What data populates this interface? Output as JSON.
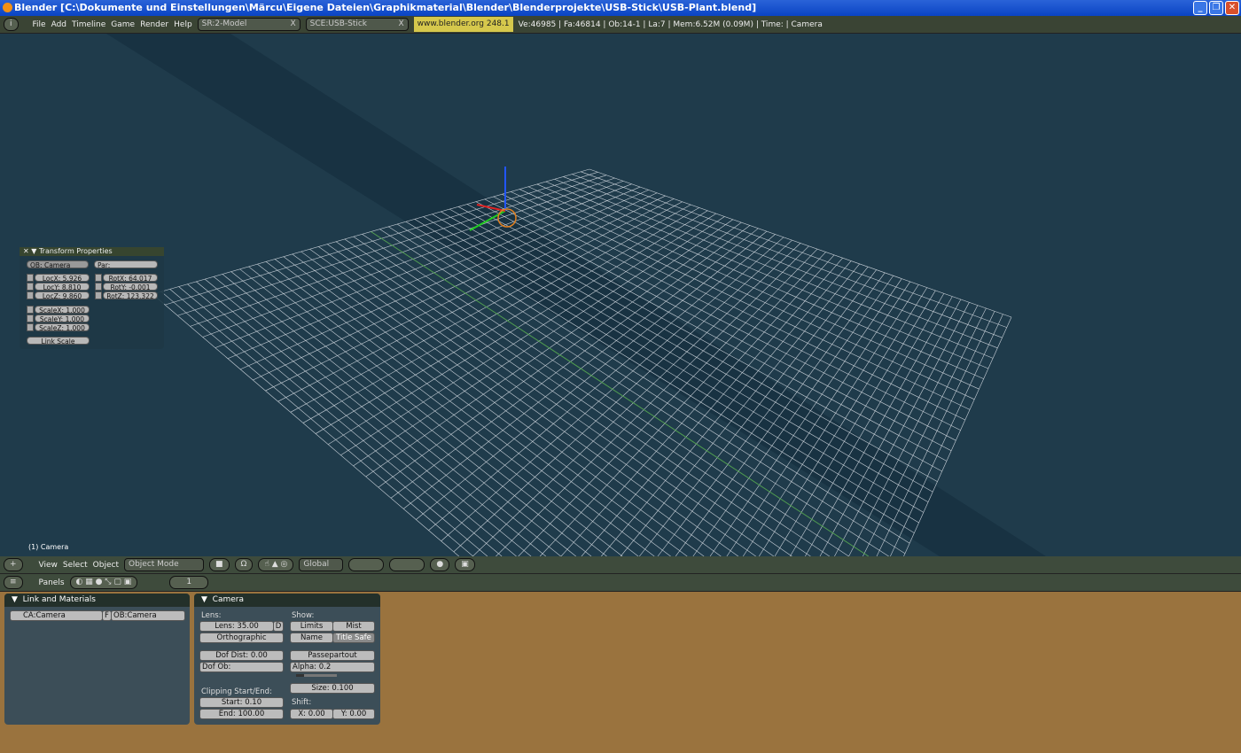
{
  "window": {
    "title": "Blender [C:\\Dokumente und Einstellungen\\Märcu\\Eigene Dateien\\Graphikmaterial\\Blender\\Blenderprojekte\\USB-Stick\\USB-Plant.blend]",
    "buttons": [
      "_",
      "❐",
      "✕"
    ]
  },
  "menubar": {
    "items": [
      "File",
      "Add",
      "Timeline",
      "Game",
      "Render",
      "Help"
    ],
    "screen": "SR:2-Model",
    "scene": "SCE:USB-Stick",
    "website": "www.blender.org 248.1",
    "stats": "Ve:46985 | Fa:46814 | Ob:14-1 | La:7  | Mem:6.52M (0.09M) | Time: | Camera"
  },
  "transform": {
    "title": "Transform Properties",
    "ob": "OB: Camera",
    "par": "Par:",
    "loc": [
      "LocX: 5.926",
      "LocY: 8.810",
      "LocZ: 9.860"
    ],
    "rot": [
      "RotX: 64.017",
      "RotY: -0.001",
      "RotZ: 123.322"
    ],
    "scale": [
      "ScaleX: 1.000",
      "ScaleY: 1.000",
      "ScaleZ: 1.000"
    ],
    "link_scale": "Link Scale"
  },
  "viewport": {
    "object_label": "(1) Camera",
    "colors": {
      "background": "#1f3b4b",
      "grid": "#c8d0d8"
    }
  },
  "view_header": {
    "menus": [
      "View",
      "Select",
      "Object"
    ],
    "mode": "Object Mode",
    "orientation": "Global"
  },
  "buttons_header": {
    "panels": "Panels",
    "frame": "1"
  },
  "link_materials": {
    "title": "Link and Materials",
    "ca": "CA:Camera",
    "f": "F",
    "ob": "OB:Camera"
  },
  "camera": {
    "title": "Camera",
    "lens_label": "Lens:",
    "lens": "Lens: 35.00",
    "d": "D",
    "ortho": "Orthographic",
    "show_label": "Show:",
    "limits": "Limits",
    "mist": "Mist",
    "name": "Name",
    "title_safe": "Title Safe",
    "dof_dist": "Dof Dist: 0.00",
    "dof_ob": "Dof Ob:",
    "passepartout": "Passepartout",
    "alpha": "Alpha: 0.2",
    "alpha_value": 0.2,
    "clip_label": "Clipping Start/End:",
    "start": "Start: 0.10",
    "end": "End: 100.00",
    "size": "Size: 0.100",
    "shift_label": "Shift:",
    "shift_x": "X: 0.00",
    "shift_y": "Y: 0.00"
  }
}
